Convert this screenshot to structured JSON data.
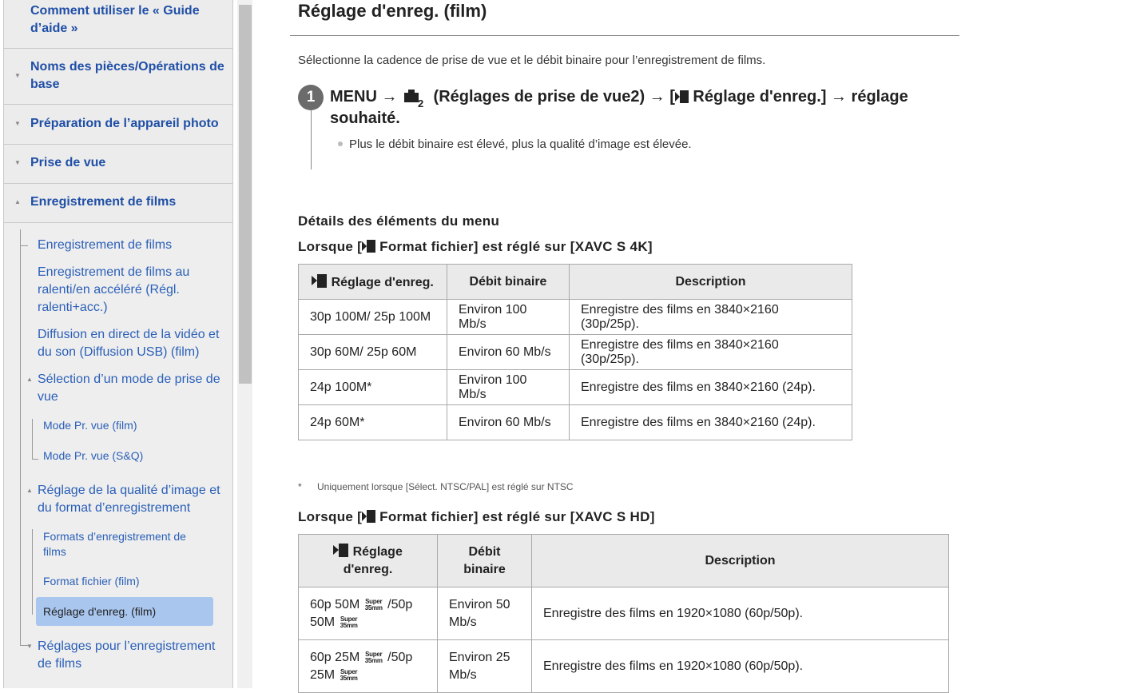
{
  "sidebar": {
    "main_items": [
      {
        "label": "Comment utiliser le « Guide d’aide »"
      },
      {
        "label": "Noms des pièces/Opérations de base"
      },
      {
        "label": "Préparation de l’appareil photo"
      },
      {
        "label": "Prise de vue"
      },
      {
        "label": "Enregistrement de films"
      }
    ],
    "sub_items": [
      {
        "label": "Enregistrement de films"
      },
      {
        "label": "Enregistrement de films au ralenti/en accéléré (Régl. ralenti+acc.)"
      },
      {
        "label": "Diffusion en direct de la vidéo et du son (Diffusion USB) (film)"
      },
      {
        "label": "Sélection d’un mode de prise de vue"
      },
      {
        "label": "Réglage de la qualité d’image et du format d’enregistrement"
      },
      {
        "label": "Réglages pour l’enregistrement de films"
      }
    ],
    "sub2_items": [
      {
        "label": "Mode Pr. vue (film)"
      },
      {
        "label": "Mode Pr. vue (S&Q)"
      },
      {
        "label": "Formats d’enregistrement de films"
      },
      {
        "label": "Format fichier (film)"
      },
      {
        "label": "Réglage d'enreg. (film)"
      }
    ]
  },
  "main": {
    "title": "Réglage d'enreg. (film)",
    "intro": "Sélectionne la cadence de prise de vue et le débit binaire pour l’enregistrement de films.",
    "step": {
      "number": "1",
      "text_a": "MENU → ",
      "icon_sub": "2",
      "text_b": " (Réglages de prise de vue2) → [",
      "text_c": " Réglage d'enreg.] → réglage souhaité.",
      "bullet": "Plus le débit binaire est élevé, plus la qualité d’image est élevée."
    },
    "menu_details_heading": "Détails des éléments du menu",
    "section1": {
      "heading_a": "Lorsque [",
      "heading_b": " Format fichier] est réglé sur [XAVC S 4K]",
      "headers": [
        "Réglage d'enreg.",
        "Débit binaire",
        "Description"
      ],
      "rows": [
        [
          "30p 100M/ 25p 100M",
          "Environ 100 Mb/s",
          "Enregistre des films en 3840×2160 (30p/25p)."
        ],
        [
          "30p 60M/ 25p 60M",
          "Environ 60 Mb/s",
          "Enregistre des films en 3840×2160 (30p/25p)."
        ],
        [
          "24p 100M*",
          "Environ 100 Mb/s",
          "Enregistre des films en 3840×2160 (24p)."
        ],
        [
          "24p 60M*",
          "Environ 60 Mb/s",
          "Enregistre des films en 3840×2160 (24p)."
        ]
      ]
    },
    "footnote": {
      "marker": "*",
      "text": "Uniquement lorsque [Sélect. NTSC/PAL] est réglé sur NTSC"
    },
    "section2": {
      "heading_a": "Lorsque [",
      "heading_b": " Format fichier] est réglé sur [XAVC S HD]",
      "headers": [
        "Réglage d'enreg.",
        "Débit binaire",
        "Description"
      ],
      "rows": [
        {
          "a1": "60p 50M",
          "a2": "/50p",
          "a3": "50M",
          "rate": "Environ 50 Mb/s",
          "desc": "Enregistre des films en 1920×1080 (60p/50p)."
        },
        {
          "a1": "60p 25M",
          "a2": "/50p",
          "a3": "25M",
          "rate": "Environ 25 Mb/s",
          "desc": "Enregistre des films en 1920×1080 (60p/50p)."
        }
      ],
      "super_top": "Super",
      "super_bottom": "35mm"
    }
  }
}
